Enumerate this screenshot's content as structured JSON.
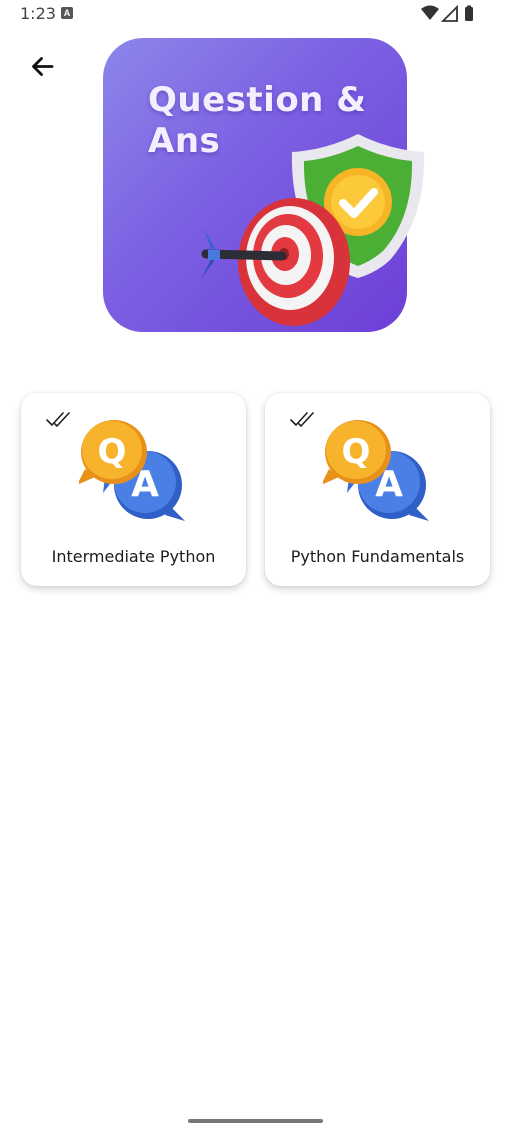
{
  "status_bar": {
    "time": "1:23",
    "notification_glyph": "A"
  },
  "header": {
    "back_icon": "arrow-left-icon",
    "banner_title": "Question & Ans"
  },
  "cards": [
    {
      "label": "Intermediate Python",
      "icon": "qa-chat-icon",
      "status_icon": "double-check-icon"
    },
    {
      "label": "Python Fundamentals",
      "icon": "qa-chat-icon",
      "status_icon": "double-check-icon"
    }
  ],
  "colors": {
    "banner_start": "#8d86ea",
    "banner_end": "#6d3fd6",
    "q_bubble": "#f5a623",
    "a_bubble": "#3b6fd8"
  }
}
